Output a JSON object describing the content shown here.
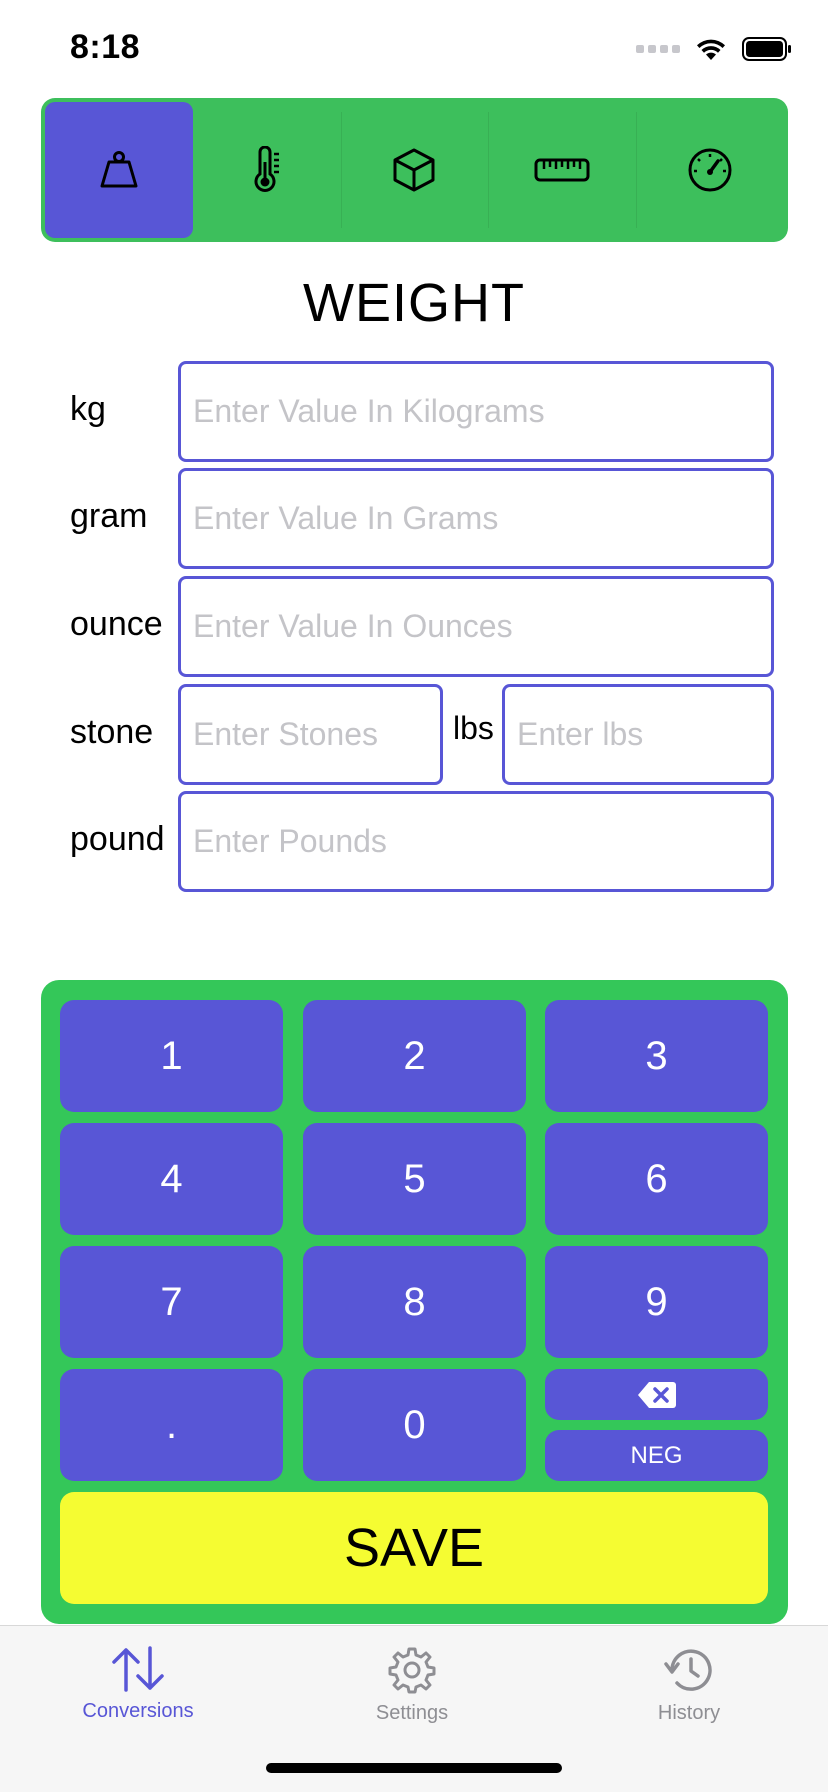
{
  "status_bar": {
    "time": "8:18"
  },
  "categories": [
    {
      "icon": "weight-icon",
      "active": true
    },
    {
      "icon": "thermometer-icon",
      "active": false
    },
    {
      "icon": "cube-icon",
      "active": false
    },
    {
      "icon": "ruler-icon",
      "active": false
    },
    {
      "icon": "speedometer-icon",
      "active": false
    }
  ],
  "page_title": "WEIGHT",
  "rows": {
    "kg": {
      "label": "kg",
      "placeholder": "Enter Value In Kilograms",
      "value": ""
    },
    "gram": {
      "label": "gram",
      "placeholder": "Enter Value In Grams",
      "value": ""
    },
    "ounce": {
      "label": "ounce",
      "placeholder": "Enter Value In Ounces",
      "value": ""
    },
    "stone": {
      "label": "stone",
      "placeholder": "Enter Stones",
      "value": "",
      "lbs_label": "lbs",
      "lbs_placeholder": "Enter lbs",
      "lbs_value": ""
    },
    "pound": {
      "label": "pound",
      "placeholder": "Enter Pounds",
      "value": ""
    }
  },
  "keypad": {
    "digits": [
      "1",
      "2",
      "3",
      "4",
      "5",
      "6",
      "7",
      "8",
      "9",
      ".",
      "0"
    ],
    "neg_label": "NEG",
    "save_label": "SAVE"
  },
  "tab_bar": {
    "items": [
      {
        "label": "Conversions",
        "icon": "arrows-up-down-icon",
        "active": true
      },
      {
        "label": "Settings",
        "icon": "gear-icon",
        "active": false
      },
      {
        "label": "History",
        "icon": "history-clock-icon",
        "active": false
      }
    ]
  },
  "colors": {
    "accent": "#5856d6",
    "green": "#34c759",
    "save": "#f5fc32",
    "inactive": "#8e8e93"
  }
}
